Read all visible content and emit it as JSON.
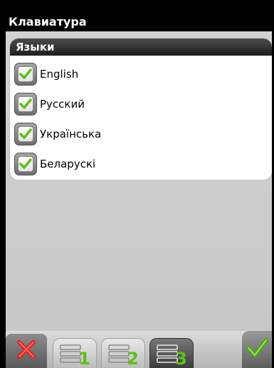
{
  "window": {
    "title": "Клавиатура"
  },
  "languages_group": {
    "title": "Языки",
    "items": [
      {
        "label": "English",
        "checked": true
      },
      {
        "label": "Русский",
        "checked": true
      },
      {
        "label": "Українська",
        "checked": true
      },
      {
        "label": "Беларускі",
        "checked": true
      }
    ]
  },
  "toolbar": {
    "cancel_icon": "close-icon",
    "pages": [
      {
        "number": "1",
        "active": false
      },
      {
        "number": "2",
        "active": false
      },
      {
        "number": "3",
        "active": true
      }
    ],
    "ok_icon": "checkmark-icon"
  },
  "colors": {
    "accent_green": "#5fbf1a",
    "cancel_red": "#e02020",
    "header_dark": "#1e1e1e"
  }
}
